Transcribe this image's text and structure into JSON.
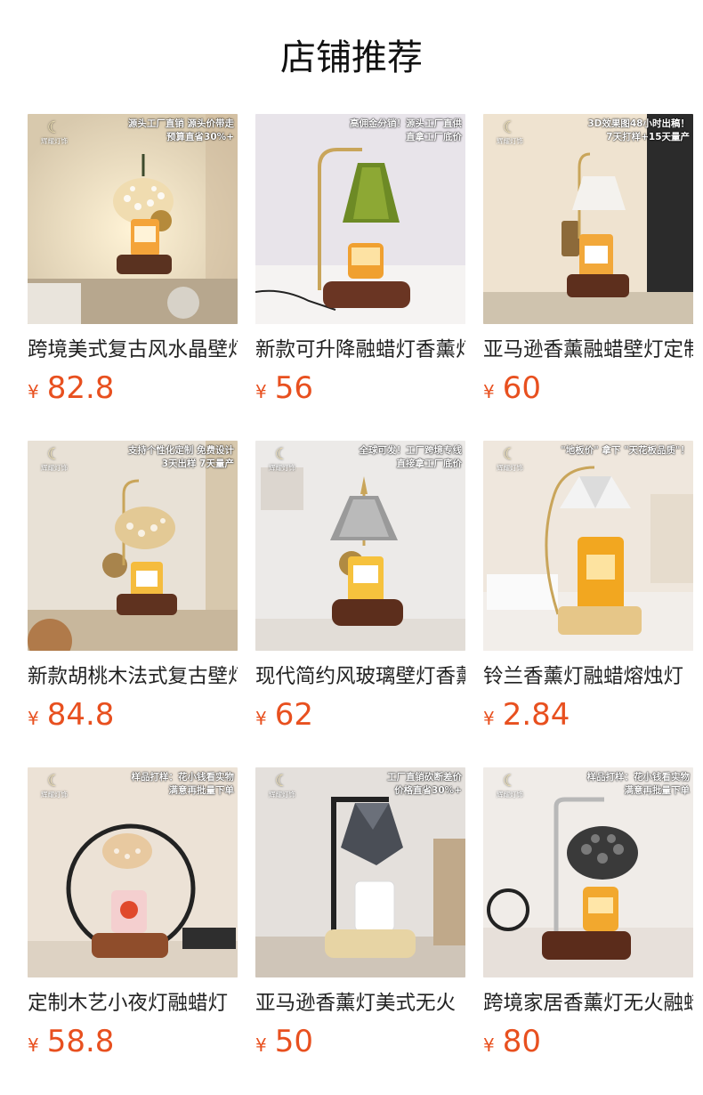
{
  "page": {
    "title": "店铺推荐"
  },
  "colors": {
    "price": "#e8501f",
    "title": "#222222"
  },
  "products": [
    {
      "title": "跨境美式复古风水晶壁灯",
      "currency": "¥",
      "price": "82.8",
      "banner": [
        "源头工厂直销 源头价带走",
        "预算直省30%+"
      ],
      "logo": "辉耀灯饰",
      "icon": "crystal-wall-lamp-icon"
    },
    {
      "title": "新款可升降融蜡灯香薰灯",
      "currency": "¥",
      "price": "56",
      "banner": [
        "高佣金分销！源头工厂直供",
        "直拿工厂底价"
      ],
      "logo": "",
      "icon": "green-glass-lamp-icon"
    },
    {
      "title": "亚马逊香薰融蜡壁灯定制",
      "currency": "¥",
      "price": "60",
      "banner": [
        "3D效果图48小时出稿！",
        "7天打样+15天量产"
      ],
      "logo": "辉耀灯饰",
      "icon": "white-shade-wall-lamp-icon"
    },
    {
      "title": "新款胡桃木法式复古壁灯",
      "currency": "¥",
      "price": "84.8",
      "banner": [
        "支持个性化定制 免费设计",
        "3天出样 7天量产"
      ],
      "logo": "辉耀灯饰",
      "icon": "crystal-wall-lamp-icon"
    },
    {
      "title": "现代简约风玻璃壁灯香薰",
      "currency": "¥",
      "price": "62",
      "banner": [
        "全球可发！工厂跨境专线",
        "直接拿工厂底价"
      ],
      "logo": "辉耀灯饰",
      "icon": "silver-cone-lamp-icon"
    },
    {
      "title": "铃兰香薰灯融蜡熔烛灯",
      "currency": "¥",
      "price": "2.84",
      "banner": [
        "\"地板价\" 拿下 \"天花板品质\"！"
      ],
      "logo": "辉耀灯饰",
      "icon": "glass-diamond-lamp-icon"
    },
    {
      "title": "定制木艺小夜灯融蜡灯",
      "currency": "¥",
      "price": "58.8",
      "banner": [
        "样品打样：花小钱看实物",
        "满意再批量下单"
      ],
      "logo": "辉耀灯饰",
      "icon": "ring-lamp-icon"
    },
    {
      "title": "亚马逊香薰灯美式无火",
      "currency": "¥",
      "price": "50",
      "banner": [
        "工厂直销砍断差价",
        "价格直省30%+"
      ],
      "logo": "辉耀灯饰",
      "icon": "geometric-lamp-icon"
    },
    {
      "title": "跨境家居香薰灯无火融蜡",
      "currency": "¥",
      "price": "80",
      "banner": [
        "样品打样：花小钱看实物",
        "满意再批量下单"
      ],
      "logo": "辉耀灯饰",
      "icon": "black-crystal-lamp-icon"
    }
  ]
}
